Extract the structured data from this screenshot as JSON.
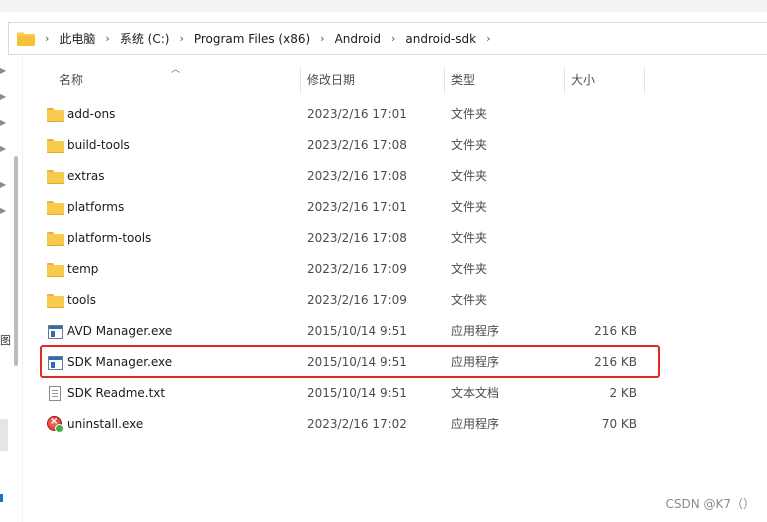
{
  "breadcrumb": [
    "此电脑",
    "系统 (C:)",
    "Program Files (x86)",
    "Android",
    "android-sdk"
  ],
  "breadcrumb_separator": "›",
  "columns": {
    "name": "名称",
    "date": "修改日期",
    "type": "类型",
    "size": "大小"
  },
  "rows": [
    {
      "name": "add-ons",
      "date": "2023/2/16 17:01",
      "type": "文件夹",
      "size": "",
      "icon": "folder-icon"
    },
    {
      "name": "build-tools",
      "date": "2023/2/16 17:08",
      "type": "文件夹",
      "size": "",
      "icon": "folder-icon"
    },
    {
      "name": "extras",
      "date": "2023/2/16 17:08",
      "type": "文件夹",
      "size": "",
      "icon": "folder-icon"
    },
    {
      "name": "platforms",
      "date": "2023/2/16 17:01",
      "type": "文件夹",
      "size": "",
      "icon": "folder-icon"
    },
    {
      "name": "platform-tools",
      "date": "2023/2/16 17:08",
      "type": "文件夹",
      "size": "",
      "icon": "folder-icon"
    },
    {
      "name": "temp",
      "date": "2023/2/16 17:09",
      "type": "文件夹",
      "size": "",
      "icon": "folder-icon"
    },
    {
      "name": "tools",
      "date": "2023/2/16 17:09",
      "type": "文件夹",
      "size": "",
      "icon": "folder-icon"
    },
    {
      "name": "AVD Manager.exe",
      "date": "2015/10/14 9:51",
      "type": "应用程序",
      "size": "216 KB",
      "icon": "exe-icon"
    },
    {
      "name": "SDK Manager.exe",
      "date": "2015/10/14 9:51",
      "type": "应用程序",
      "size": "216 KB",
      "icon": "exe-icon"
    },
    {
      "name": "SDK Readme.txt",
      "date": "2015/10/14 9:51",
      "type": "文本文档",
      "size": "2 KB",
      "icon": "text-file-icon"
    },
    {
      "name": "uninstall.exe",
      "date": "2023/2/16 17:02",
      "type": "应用程序",
      "size": "70 KB",
      "icon": "uninstall-icon"
    }
  ],
  "left_pane": {
    "partial_label": "图"
  },
  "watermark": "CSDN @K7（）",
  "colors": {
    "highlight": "#e02a22",
    "folder": "#f8ca4d",
    "accent": "#1f6fd1"
  }
}
